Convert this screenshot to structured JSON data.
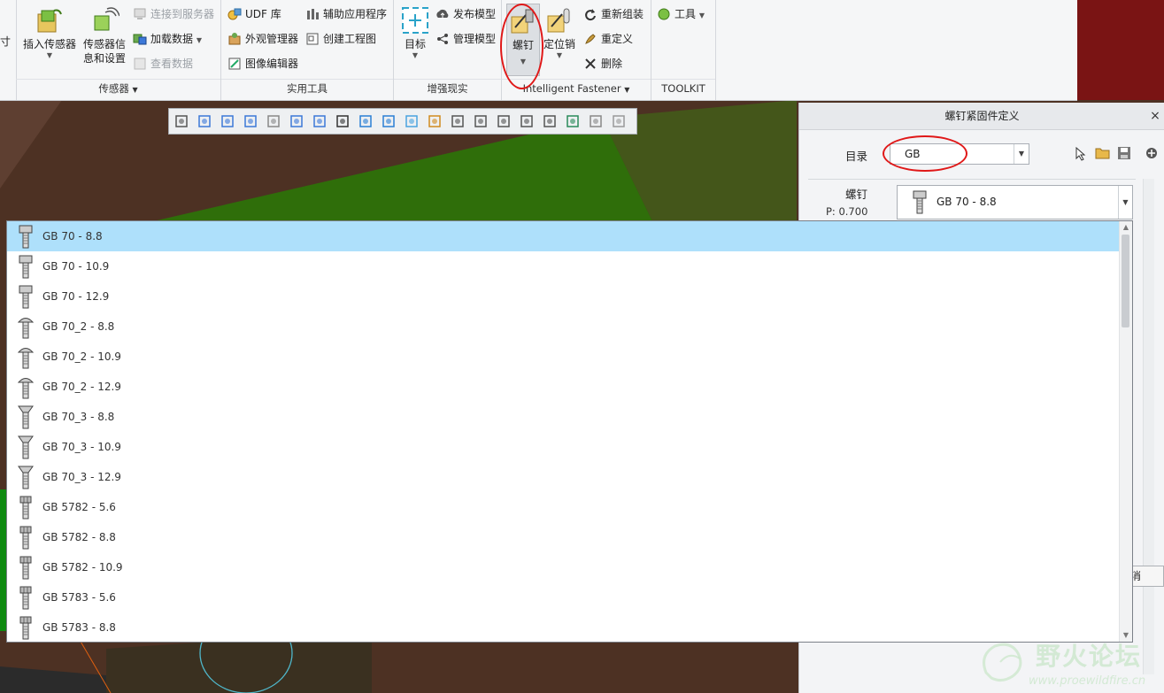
{
  "ribbon": {
    "left_cut_label": "寸",
    "sensors_group": {
      "title": "传感器",
      "insert_sensor": "插入传感器",
      "sensor_info_line1": "传感器信",
      "sensor_info_line2": "息和设置",
      "connect_server": "连接到服务器",
      "load_data": "加载数据",
      "view_data": "查看数据"
    },
    "utilities_group": {
      "title": "实用工具",
      "udf_lib": "UDF 库",
      "aux_app": "辅助应用程序",
      "appearance_mgr": "外观管理器",
      "create_drawing": "创建工程图",
      "image_editor": "图像编辑器"
    },
    "ar_group": {
      "title": "增强现实",
      "target": "目标",
      "publish_model": "发布模型",
      "manage_model": "管理模型"
    },
    "fastener_group": {
      "title": "Intelligent Fastener",
      "screw": "螺钉",
      "dowel": "定位销",
      "reassemble": "重新组装",
      "redefine": "重定义",
      "delete": "删除"
    },
    "toolkit_group": {
      "title": "TOOLKIT",
      "tools": "工具"
    }
  },
  "view_toolbar": {
    "icons": [
      "zoom-fit-icon",
      "zoom-in-icon",
      "zoom-out-icon",
      "repaint-icon",
      "perspective-icon",
      "shading-icon",
      "saved-views-icon",
      "camera-icon",
      "display-style-icon",
      "spin-center-icon",
      "view-manager-icon",
      "datum-display-icon",
      "plane-display-icon",
      "axis-display-icon",
      "point-display-icon",
      "csys-display-icon",
      "annotation-display-icon",
      "network-icon",
      "render-icon",
      "section-icon"
    ]
  },
  "panel": {
    "title": "螺钉紧固件定义",
    "close": "×",
    "catalog_label": "目录",
    "catalog_value": "GB",
    "screw_label": "螺钉",
    "pitch": "P: 0.700",
    "screw_value": "GB 70 - 8.8",
    "cancel_fragment": "消"
  },
  "screw_list": {
    "items": [
      {
        "label": "GB 70 - 8.8",
        "head": "socket"
      },
      {
        "label": "GB 70 - 10.9",
        "head": "socket"
      },
      {
        "label": "GB 70 - 12.9",
        "head": "socket"
      },
      {
        "label": "GB 70_2 - 8.8",
        "head": "button"
      },
      {
        "label": "GB 70_2 - 10.9",
        "head": "button"
      },
      {
        "label": "GB 70_2 - 12.9",
        "head": "button"
      },
      {
        "label": "GB 70_3 - 8.8",
        "head": "countersunk"
      },
      {
        "label": "GB 70_3 - 10.9",
        "head": "countersunk"
      },
      {
        "label": "GB 70_3 - 12.9",
        "head": "countersunk"
      },
      {
        "label": "GB 5782 - 5.6",
        "head": "hex"
      },
      {
        "label": "GB 5782 - 8.8",
        "head": "hex"
      },
      {
        "label": "GB 5782 - 10.9",
        "head": "hex"
      },
      {
        "label": "GB 5783 - 5.6",
        "head": "hex"
      },
      {
        "label": "GB 5783 - 8.8",
        "head": "hex"
      }
    ],
    "selected": "GB 70 - 8.8"
  },
  "watermark": {
    "title": "野火论坛",
    "url": "www.proewildfire.cn"
  },
  "colors": {
    "accent_highlight": "#aee0fb",
    "annotation_red": "#e01818",
    "ribbon_bg": "#f5f6f7",
    "viewport_green": "#2f6e0a",
    "viewport_brown": "#4d3123"
  }
}
